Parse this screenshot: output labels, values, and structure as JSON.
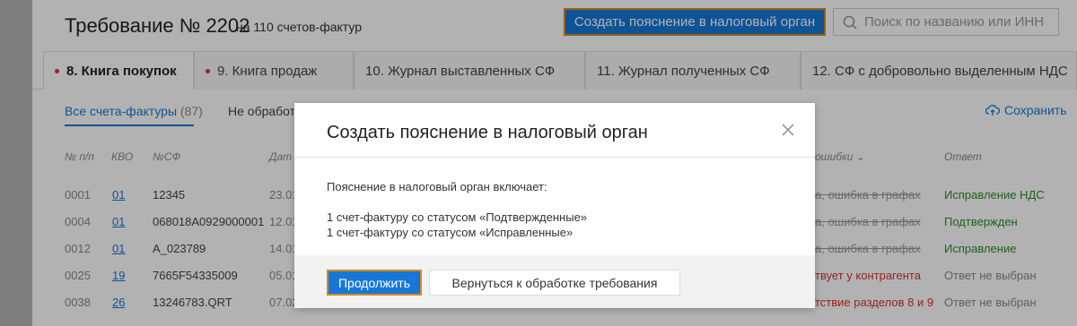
{
  "header": {
    "title": "Требование № 2202",
    "subtitle": "на 110 счетов-фактур",
    "create_button": "Создать пояснение в налоговый орган",
    "search_placeholder": "Поиск по названию или ИНН"
  },
  "tabs": [
    {
      "label": "8. Книга покупок",
      "marked": true
    },
    {
      "label": "9. Книга продаж",
      "marked": true
    },
    {
      "label": "10. Журнал выставленных СФ",
      "marked": false
    },
    {
      "label": "11. Журнал полученных СФ",
      "marked": false
    },
    {
      "label": "12. СФ с добровольно выделенным НДС",
      "marked": false
    }
  ],
  "subtabs": {
    "all_label": "Все счета-фактуры",
    "all_count": "(87)",
    "unprocessed": "Не обработа",
    "save": "Сохранить"
  },
  "table": {
    "headers": {
      "num": "№ п/п",
      "kvo": "КВО",
      "nsf": "№СФ",
      "date": "Дат",
      "errors": "ошибки",
      "answer": "Ответ"
    },
    "rows": [
      {
        "num": "0001",
        "kvo": "01",
        "nsf": "12345",
        "date": "23.01",
        "error": "а, ошибка в графах",
        "answer": "Исправление НДС"
      },
      {
        "num": "0004",
        "kvo": "01",
        "nsf": "068018A0929000001",
        "date": "12.01",
        "error": "а, ошибка в графах",
        "answer": "Подтвержден"
      },
      {
        "num": "0012",
        "kvo": "01",
        "nsf": "A_023789",
        "date": "14.01",
        "error": "а, ошибка в графах",
        "answer": "Исправление"
      },
      {
        "num": "0025",
        "kvo": "19",
        "nsf": "7665F54335009",
        "date": "05.01",
        "error": "твует у контрагента",
        "answer": "Ответ не выбран"
      },
      {
        "num": "0038",
        "kvo": "26",
        "nsf": "13246783.QRT",
        "date": "07.02",
        "error": "тствие разделов 8 и 9",
        "answer": "Ответ не выбран"
      }
    ]
  },
  "modal": {
    "title": "Создать пояснение в налоговый орган",
    "intro": "Пояснение в налоговый орган включает:",
    "line1": "1 счет-фактуру со статусом «Подтвержденные»",
    "line2": "1 счет-фактуру со статусом «Исправленные»",
    "continue": "Продолжить",
    "back": "Вернуться к обработке требования"
  }
}
